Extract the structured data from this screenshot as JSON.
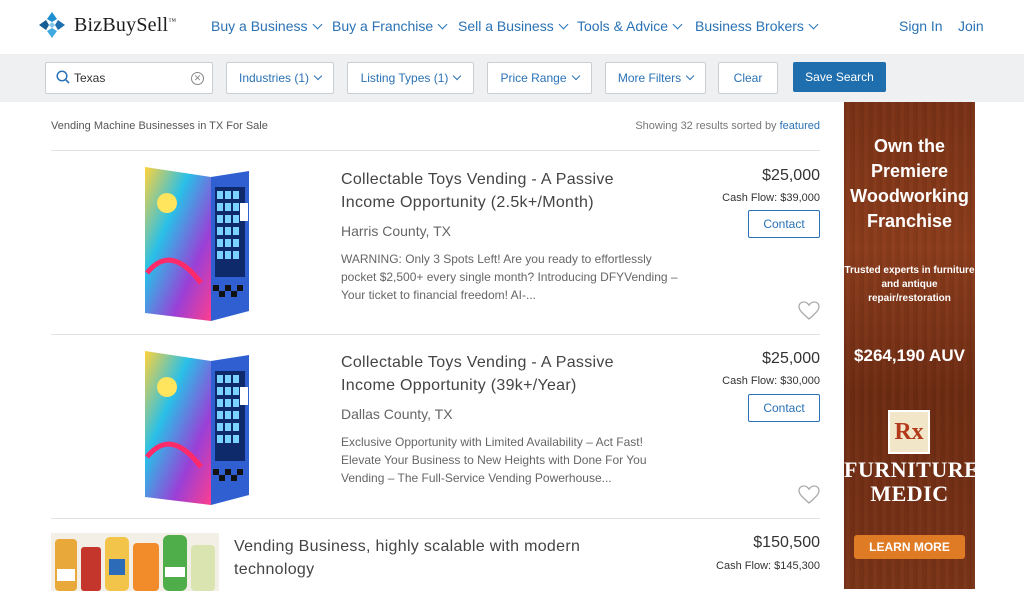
{
  "brand": {
    "name": "BizBuySell",
    "mark": "™"
  },
  "nav": {
    "items": [
      "Buy a Business",
      "Buy a Franchise",
      "Sell a Business",
      "Tools & Advice",
      "Business Brokers"
    ],
    "signin": "Sign In",
    "join": "Join"
  },
  "filters": {
    "search_value": "Texas",
    "industries": "Industries (1)",
    "listing_types": "Listing Types (1)",
    "price_range": "Price Range",
    "more_filters": "More Filters",
    "clear": "Clear",
    "save_search": "Save Search"
  },
  "results": {
    "title": "Vending Machine Businesses in TX For Sale",
    "meta_prefix": "Showing 32 results sorted by ",
    "sort": "featured"
  },
  "listings": [
    {
      "title": "Collectable Toys Vending - A Passive Income Opportunity (2.5k+/Month)",
      "location": "Harris County, TX",
      "description": "WARNING: Only 3 Spots Left! Are you ready to effortlessly pocket $2,500+ every single month? Introducing DFYVending – Your ticket to financial freedom! AI-...",
      "price": "$25,000",
      "cash_flow": "Cash Flow: $39,000",
      "contact": "Contact"
    },
    {
      "title": "Collectable Toys Vending - A Passive Income Opportunity (39k+/Year)",
      "location": "Dallas County, TX",
      "description": "Exclusive Opportunity with Limited Availability – Act Fast! Elevate Your Business to New Heights with Done For You Vending – The Full-Service Vending Powerhouse...",
      "price": "$25,000",
      "cash_flow": "Cash Flow: $30,000",
      "contact": "Contact"
    },
    {
      "title": "Vending Business, highly scalable with modern technology",
      "price": "$150,500",
      "cash_flow": "Cash Flow: $145,300"
    }
  ],
  "ad": {
    "headline": "Own the Premiere Woodworking Franchise",
    "sub": "Trusted experts in furniture and antique repair/restoration",
    "auv": "$264,190 AUV",
    "logo_text": "Rx",
    "brand_line1": "FURNITURE",
    "brand_line2": "MEDIC",
    "cta": "LEARN MORE"
  }
}
